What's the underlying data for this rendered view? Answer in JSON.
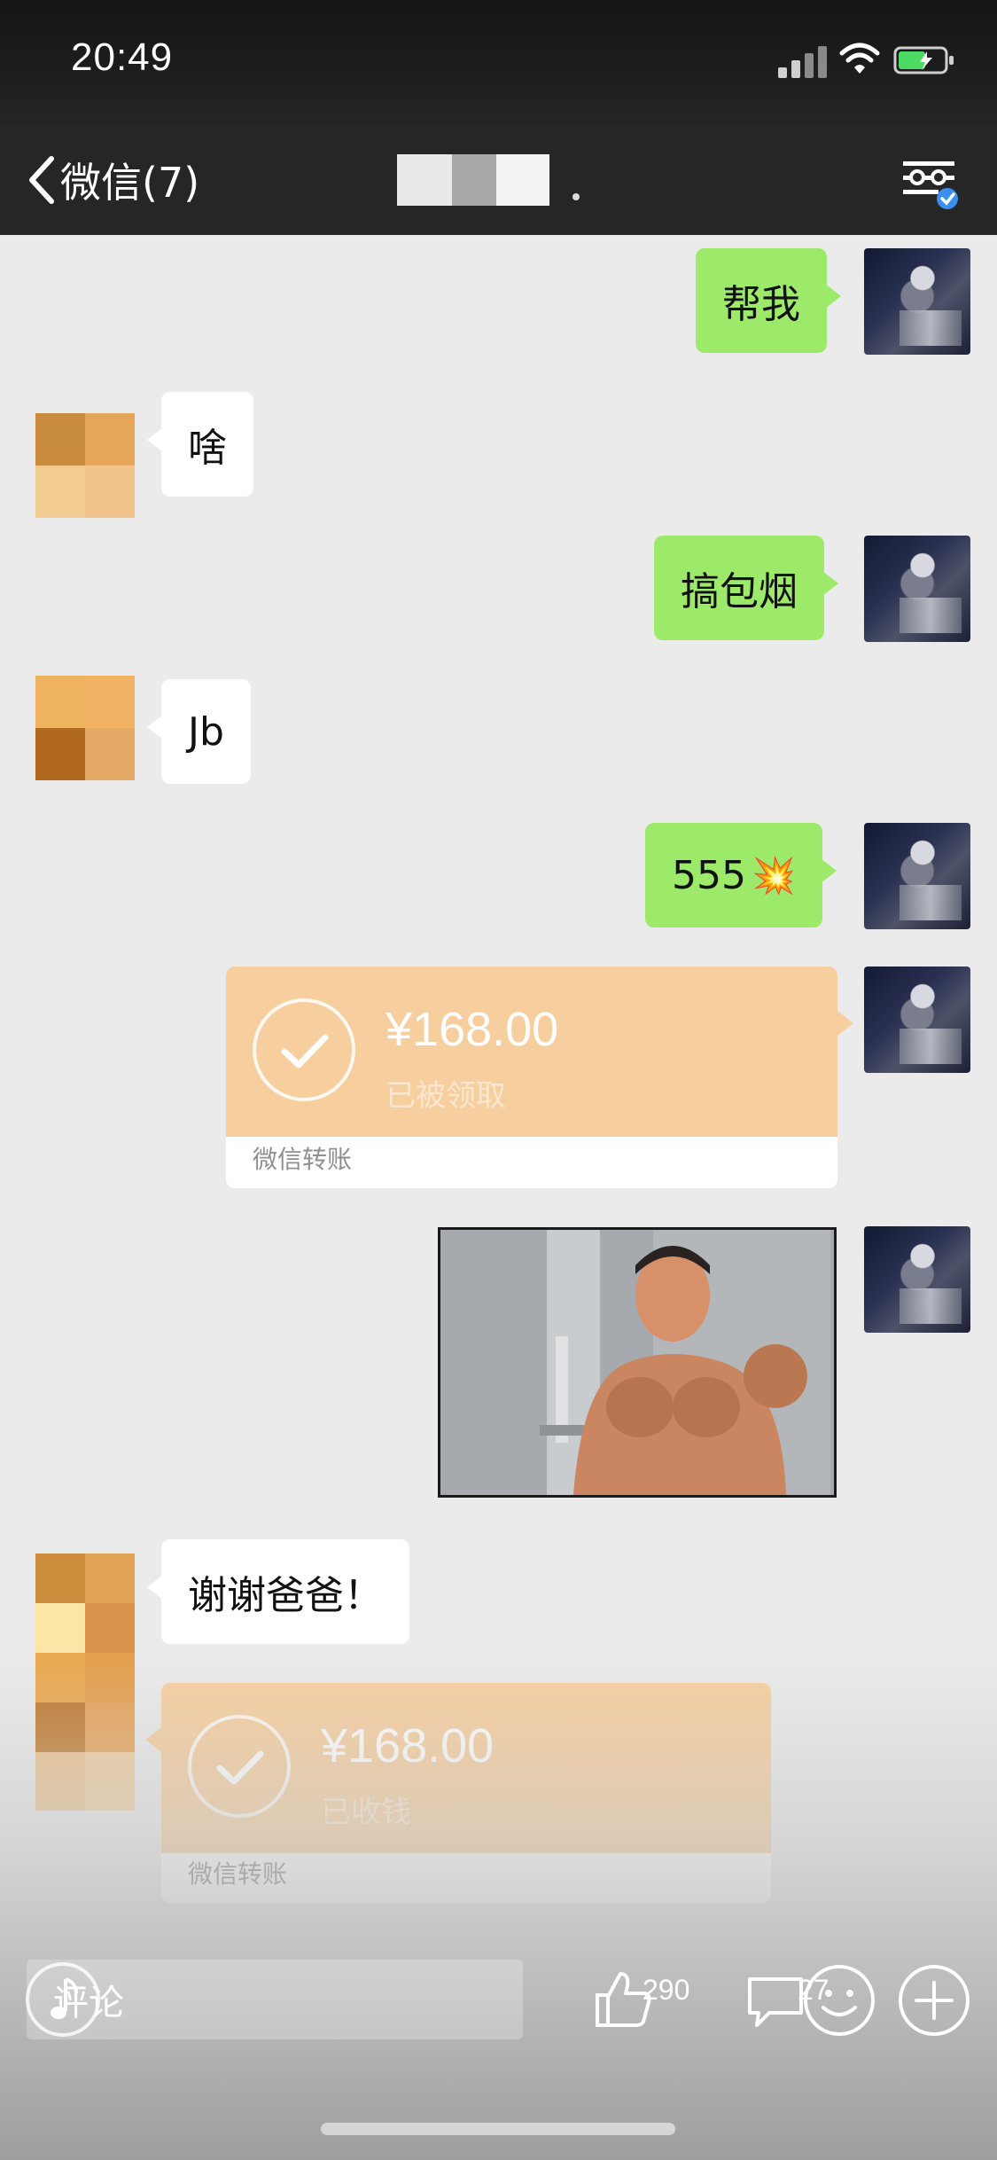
{
  "status_bar": {
    "time": "20:49"
  },
  "nav": {
    "back_label": "微信(7)"
  },
  "messages": [
    {
      "from": "me",
      "text": "帮我"
    },
    {
      "from": "other",
      "text": "啥"
    },
    {
      "from": "me",
      "text": "搞包烟"
    },
    {
      "from": "other",
      "text": "Jb"
    },
    {
      "from": "me",
      "text": "555",
      "emoji": "💥"
    },
    {
      "from": "me",
      "type": "transfer",
      "amount": "¥168.00",
      "status": "已被领取",
      "label": "微信转账"
    },
    {
      "from": "me",
      "type": "image",
      "description_icon": "photo-icon"
    },
    {
      "from": "other",
      "text": "谢谢爸爸！"
    },
    {
      "from": "other",
      "type": "transfer",
      "amount": "¥168.00",
      "status": "已收钱",
      "label": "微信转账"
    }
  ],
  "comment_bar": {
    "placeholder": "评论",
    "like_count": "290",
    "comment_count": "27"
  },
  "colors": {
    "my_bubble": "#9dea6a",
    "transfer_orange": "#f7cf9f",
    "nav_bg": "#262626"
  }
}
